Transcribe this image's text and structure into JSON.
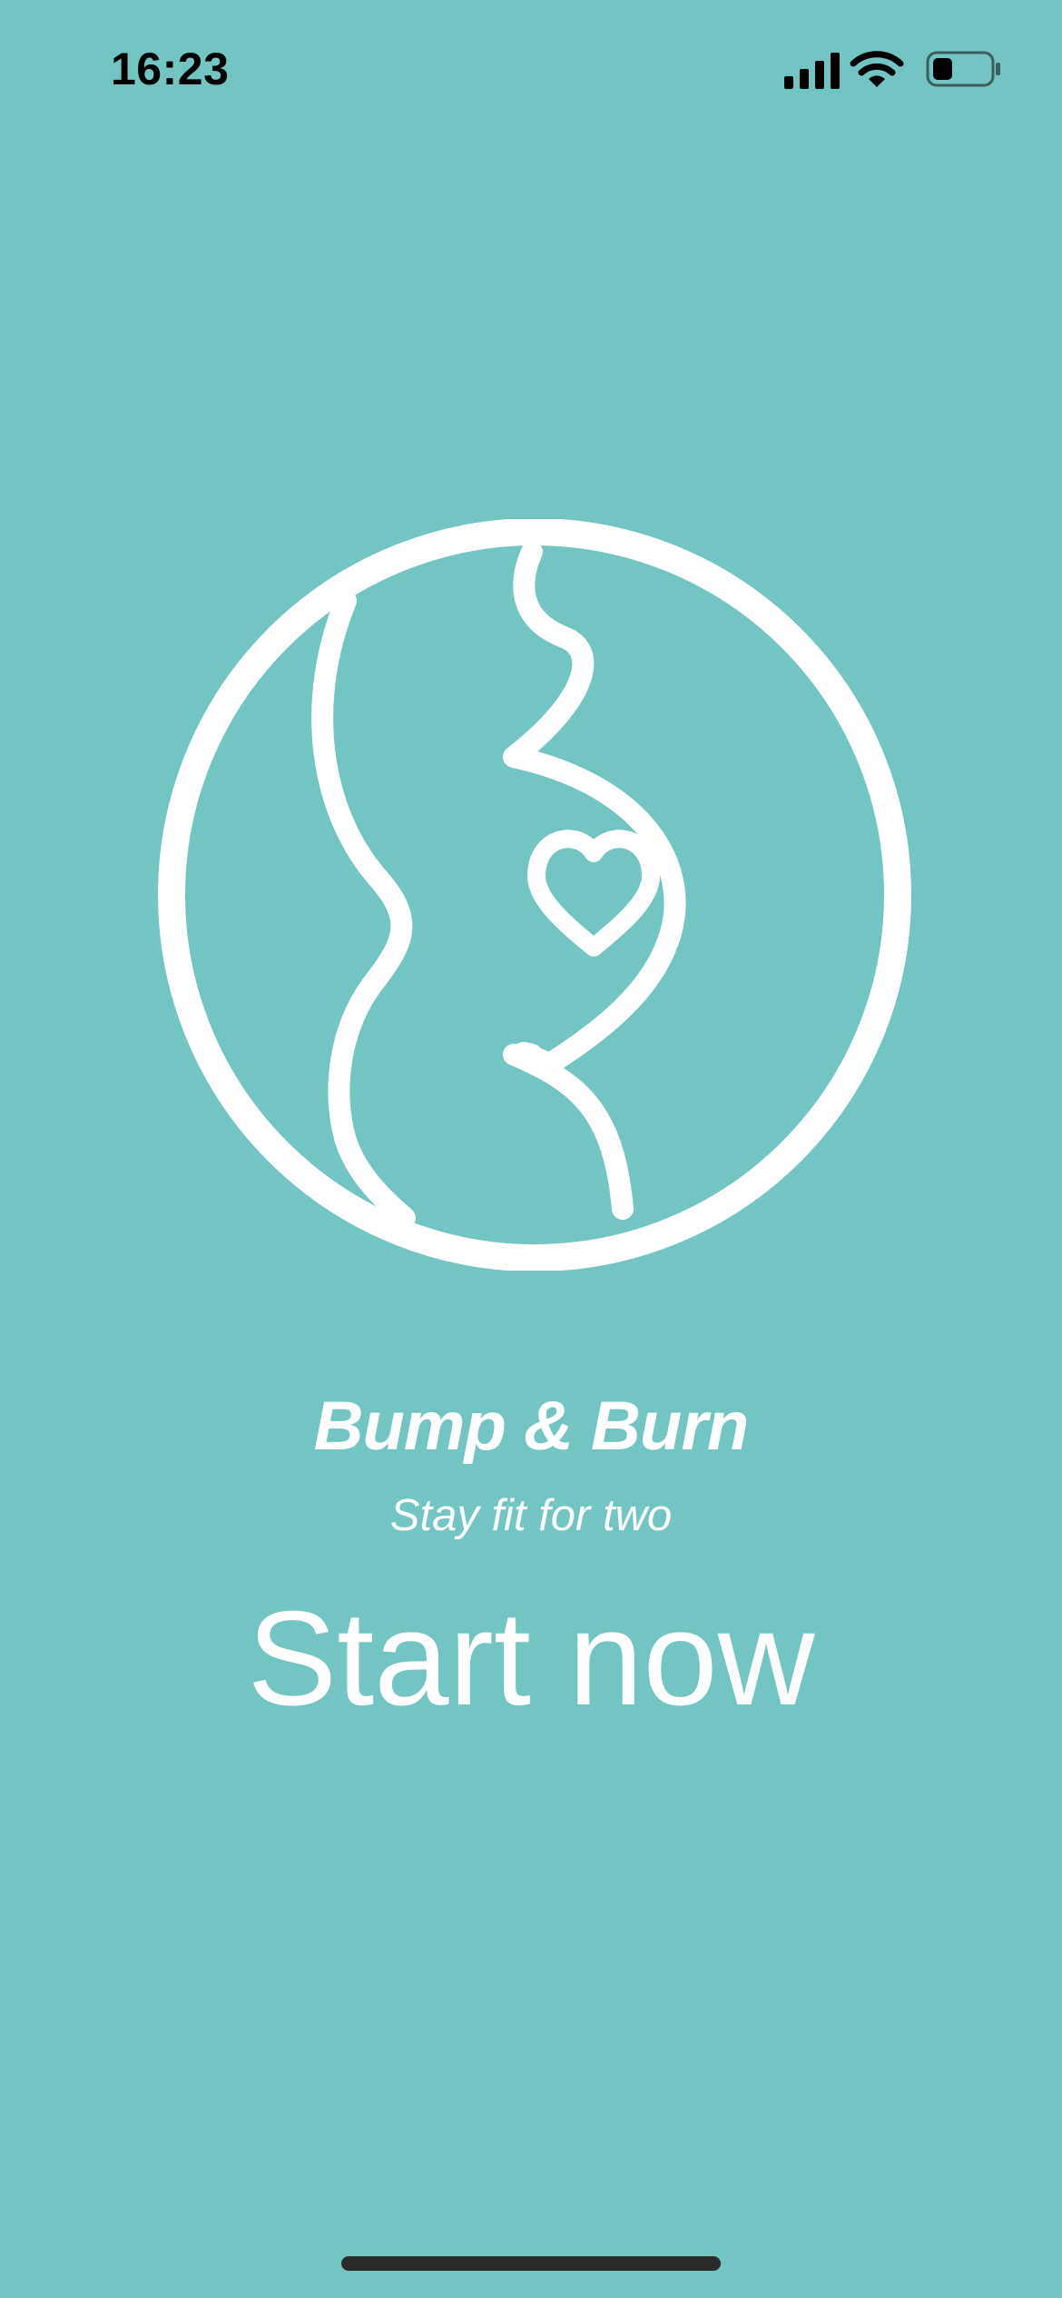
{
  "theme": {
    "background": "#72c5c3",
    "foreground": "#ffffff",
    "status_text": "#000000"
  },
  "status_bar": {
    "time": "16:23",
    "icons": [
      "signal-icon",
      "wifi-icon",
      "battery-icon"
    ],
    "battery_level": 0.35
  },
  "logo": {
    "icon": "pregnancy-heart-logo-icon"
  },
  "app": {
    "title": "Bump & Burn",
    "subtitle": "Stay fit for two"
  },
  "start": {
    "label": "Start now"
  }
}
